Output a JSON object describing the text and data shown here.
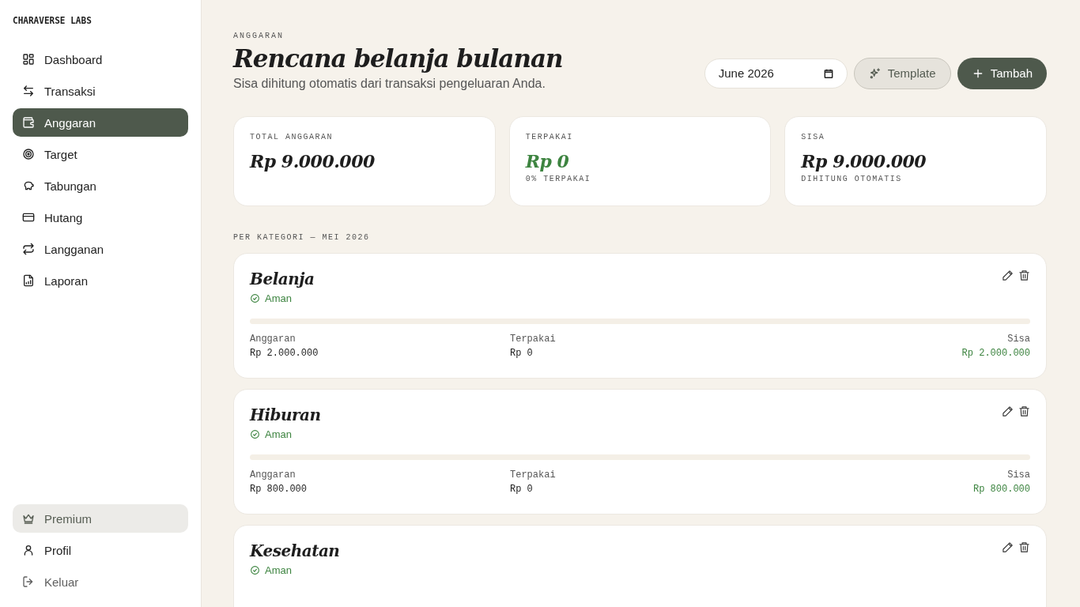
{
  "brand": "CHARAVERSE LABS",
  "nav": [
    {
      "label": "Dashboard",
      "selected": false
    },
    {
      "label": "Transaksi",
      "selected": false
    },
    {
      "label": "Anggaran",
      "selected": true
    },
    {
      "label": "Target",
      "selected": false
    },
    {
      "label": "Tabungan",
      "selected": false
    },
    {
      "label": "Hutang",
      "selected": false
    },
    {
      "label": "Langganan",
      "selected": false
    },
    {
      "label": "Laporan",
      "selected": false
    }
  ],
  "bottom_nav": [
    {
      "label": "Premium",
      "kind": "premium"
    },
    {
      "label": "Profil",
      "kind": "link"
    },
    {
      "label": "Keluar",
      "kind": "logout"
    }
  ],
  "header": {
    "eyebrow": "ANGGARAN",
    "title": "Rencana belanja bulanan",
    "subtitle": "Sisa dihitung otomatis dari transaksi pengeluaran Anda.",
    "month": "June 2026",
    "template_button": "Template",
    "add_button": "Tambah"
  },
  "summary": [
    {
      "label": "TOTAL ANGGARAN",
      "value": "Rp 9.000.000",
      "color": "#1e1e1e"
    },
    {
      "label": "TERPAKAI",
      "value": "Rp 0",
      "color": "#3d8440",
      "note": "0% TERPAKAI"
    },
    {
      "label": "SISA",
      "value": "Rp 9.000.000",
      "color": "#1e1e1e",
      "note": "DIHITUNG OTOMATIS"
    }
  ],
  "section_title": "PER KATEGORI — MEI 2026",
  "categories": [
    {
      "name": "Belanja",
      "status": "Aman",
      "level": 0,
      "budget_label": "Anggaran",
      "budget": "Rp 2.000.000",
      "spent_label": "Terpakai",
      "spent": "Rp 0",
      "left_label": "Sisa",
      "left": "Rp 2.000.000"
    },
    {
      "name": "Hiburan",
      "status": "Aman",
      "level": 0,
      "budget_label": "Anggaran",
      "budget": "Rp 800.000",
      "spent_label": "Terpakai",
      "spent": "Rp 0",
      "left_label": "Sisa",
      "left": "Rp 800.000"
    },
    {
      "name": "Kesehatan",
      "status": "Aman"
    }
  ]
}
